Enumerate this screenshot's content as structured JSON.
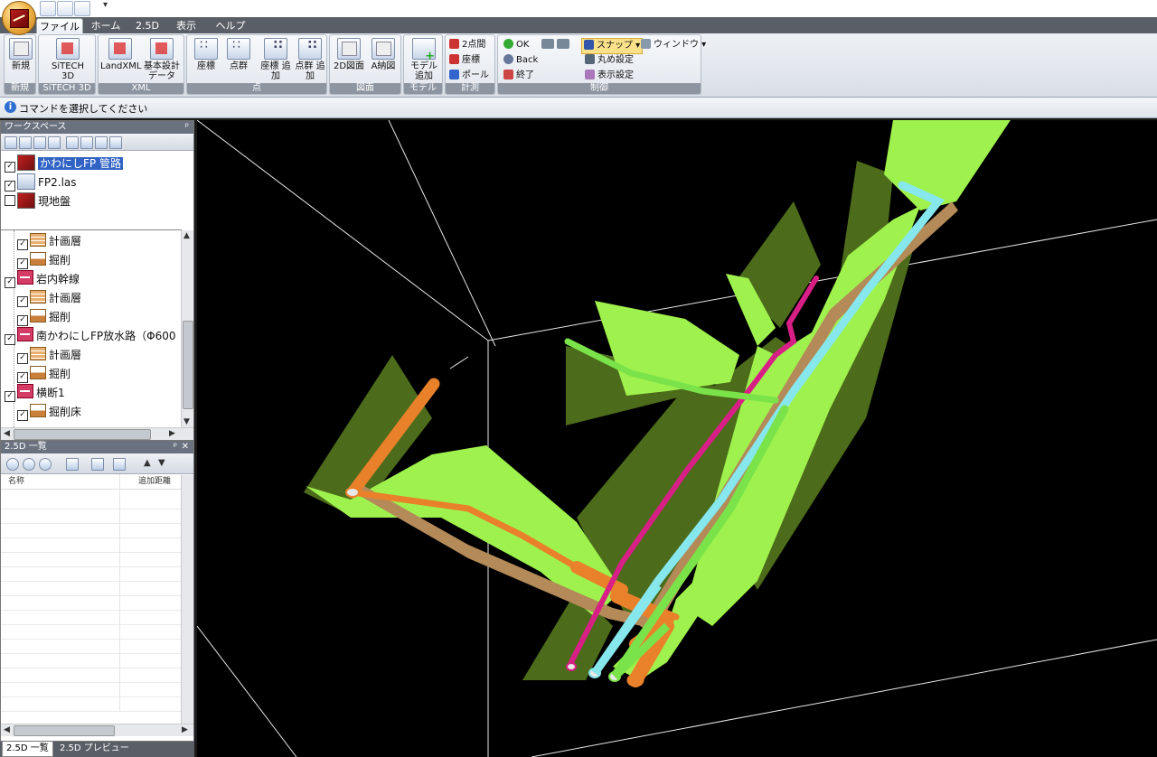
{
  "quick_access": {
    "more": "▾"
  },
  "tabs": [
    {
      "label": "ファイル",
      "active": true
    },
    {
      "label": "ホーム",
      "active": false
    },
    {
      "label": "2.5D",
      "active": false
    },
    {
      "label": "表示",
      "active": false
    },
    {
      "label": "ヘルプ",
      "active": false
    }
  ],
  "ribbon": {
    "groups": {
      "new": "新規",
      "sitech": "SiTECH 3D",
      "xml": "XML",
      "point": "点",
      "drawing": "図面",
      "model": "モデル",
      "measure": "計測",
      "control": "制御"
    },
    "buttons": {
      "new": "新規",
      "sitech3d": "SiTECH 3D",
      "landxml": "LandXML",
      "basic_design": "基本設計 データ",
      "coord": "座標",
      "point_group": "点群",
      "add_coord": "座標 追加",
      "add_point_group": "点群 追加",
      "drawing_2d": "2D図面",
      "drawing_a": "A納図",
      "add_model": "モデル 追加",
      "two_point": "2点間",
      "coord_measure": "座標",
      "pole": "ポール",
      "ok": "OK",
      "back": "Back",
      "end": "終了",
      "snap": "スナップ",
      "window": "ウィンドウ",
      "rounding": "丸め設定",
      "display_settings": "表示設定"
    }
  },
  "command": {
    "prompt": "コマンドを選択してください",
    "info_icon": "i"
  },
  "workspace": {
    "title": "ワークスペース",
    "pin": "ᵖ",
    "layers": [
      {
        "label": "かわにしFP 管路",
        "checked": true,
        "selected": true
      },
      {
        "label": "FP2.las",
        "checked": true,
        "selected": false
      },
      {
        "label": "現地盤",
        "checked": false,
        "selected": false
      }
    ],
    "tree": [
      {
        "label": "計画層",
        "level": 1,
        "checked": true,
        "icon": "plan"
      },
      {
        "label": "掘削",
        "level": 1,
        "checked": true,
        "icon": "dig"
      },
      {
        "label": "岩内幹線",
        "level": 0,
        "checked": true,
        "icon": "pipe"
      },
      {
        "label": "計画層",
        "level": 1,
        "checked": true,
        "icon": "plan"
      },
      {
        "label": "掘削",
        "level": 1,
        "checked": true,
        "icon": "dig"
      },
      {
        "label": "南かわにしFP放水路（Φ600",
        "level": 0,
        "checked": true,
        "icon": "pipe"
      },
      {
        "label": "計画層",
        "level": 1,
        "checked": true,
        "icon": "plan"
      },
      {
        "label": "掘削",
        "level": 1,
        "checked": true,
        "icon": "dig"
      },
      {
        "label": "横断1",
        "level": 0,
        "checked": true,
        "icon": "pipe"
      },
      {
        "label": "掘削床",
        "level": 1,
        "checked": true,
        "icon": "dig"
      }
    ]
  },
  "list25": {
    "title": "2.5D 一覧",
    "pin": "ᵖ",
    "close": "✕",
    "columns": [
      "名称",
      "追加距離"
    ]
  },
  "bottom_tabs": [
    {
      "label": "2.5D 一覧",
      "active": true
    },
    {
      "label": "2.5D プレビュー",
      "active": false
    }
  ],
  "colors": {
    "ground_light": "#9ef04a",
    "ground_dark": "#4d6e1c",
    "pipe_orange": "#e8812a",
    "pipe_cyan": "#86e7ec",
    "pipe_magenta": "#d81f86",
    "pipe_green": "#7be34a"
  }
}
